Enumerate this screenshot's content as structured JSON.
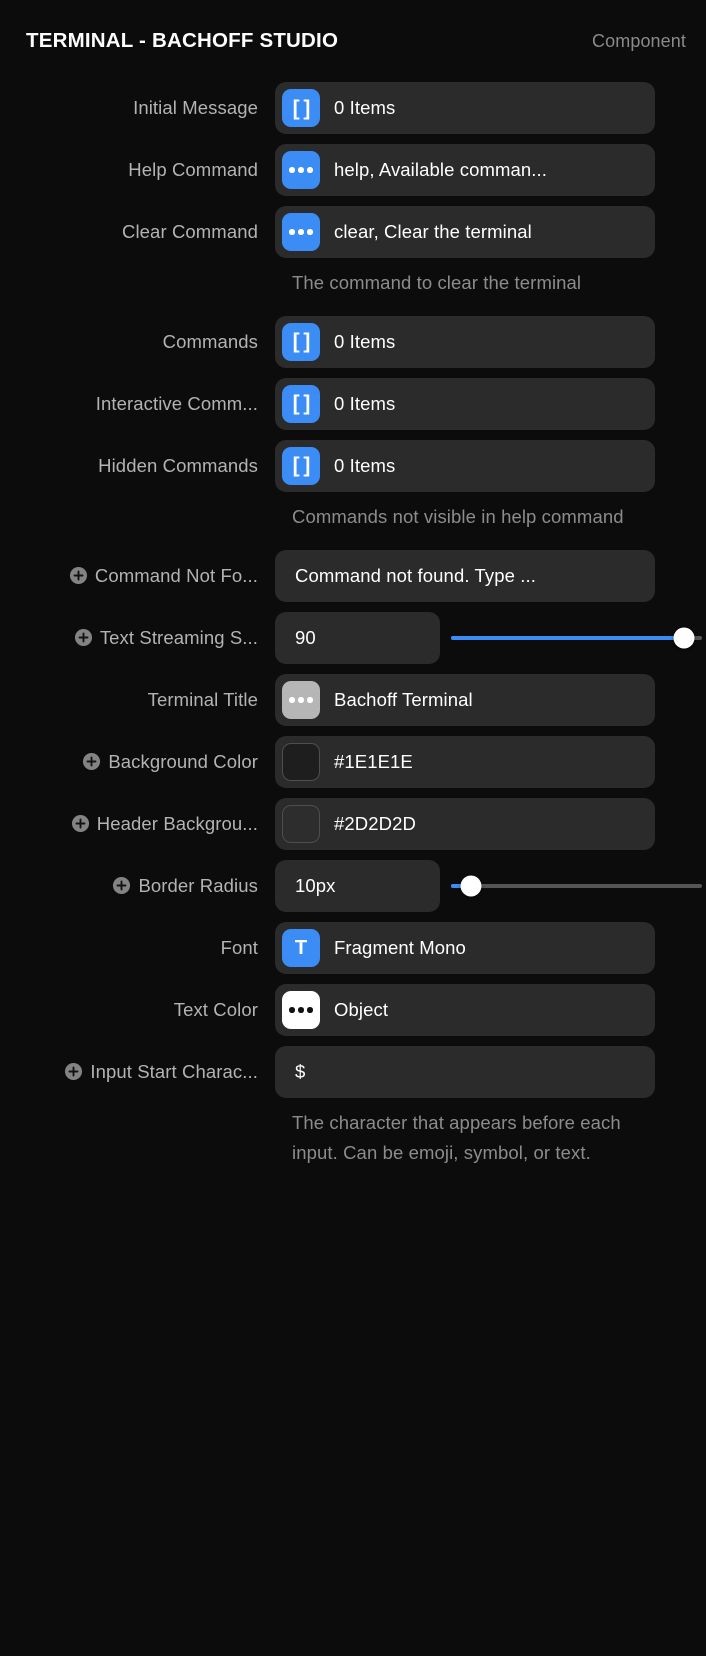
{
  "header": {
    "title": "TERMINAL - BACHOFF STUDIO",
    "kind": "Component"
  },
  "rows": {
    "initial_message": {
      "label": "Initial Message",
      "value": "0 Items",
      "icon": "array-brackets-icon"
    },
    "help_command": {
      "label": "Help Command",
      "value": "help, Available comman...",
      "icon": "object-ellipsis-icon"
    },
    "clear_command": {
      "label": "Clear Command",
      "value": "clear, Clear the terminal",
      "icon": "object-ellipsis-icon"
    },
    "clear_command_help": "The command to clear the terminal",
    "commands": {
      "label": "Commands",
      "value": "0 Items",
      "icon": "array-brackets-icon"
    },
    "interactive_commands": {
      "label": "Interactive Comm...",
      "value": "0 Items",
      "icon": "array-brackets-icon"
    },
    "hidden_commands": {
      "label": "Hidden Commands",
      "value": "0 Items",
      "icon": "array-brackets-icon"
    },
    "hidden_commands_help": "Commands not visible in help command",
    "command_not_found": {
      "label": "Command Not Fo...",
      "value": "Command not found. Type ..."
    },
    "text_streaming_speed": {
      "label": "Text Streaming S...",
      "value": "90"
    },
    "terminal_title": {
      "label": "Terminal Title",
      "value": "Bachoff Terminal",
      "icon": "ellipsis-icon"
    },
    "background_color": {
      "label": "Background Color",
      "value": "#1E1E1E",
      "icon": "color-swatch-icon"
    },
    "header_background_color": {
      "label": "Header Backgrou...",
      "value": "#2D2D2D",
      "icon": "color-swatch-icon"
    },
    "border_radius": {
      "label": "Border Radius",
      "value": "10px"
    },
    "font": {
      "label": "Font",
      "value": "Fragment Mono",
      "icon": "font-t-icon"
    },
    "text_color": {
      "label": "Text Color",
      "value": "Object",
      "icon": "object-ellipsis-icon"
    },
    "input_start_character": {
      "label": "Input Start Charac...",
      "value": "$"
    },
    "input_start_character_help": "The character that appears before each input. Can be emoji, symbol, or text."
  },
  "sliders": {
    "text_streaming_speed": {
      "percent": 93
    },
    "border_radius": {
      "percent": 8
    }
  },
  "colors": {
    "accent": "#3B8CF5",
    "panel_background": "#0C0C0C",
    "field_background": "#2B2B2B",
    "label_text": "#B3B3B3",
    "help_text": "#8C8C8C",
    "value_text": "#FFFFFF",
    "background_color_value": "#1E1E1E",
    "header_background_color_value": "#2D2D2D"
  },
  "icons": {
    "plus": "add-override-icon"
  }
}
